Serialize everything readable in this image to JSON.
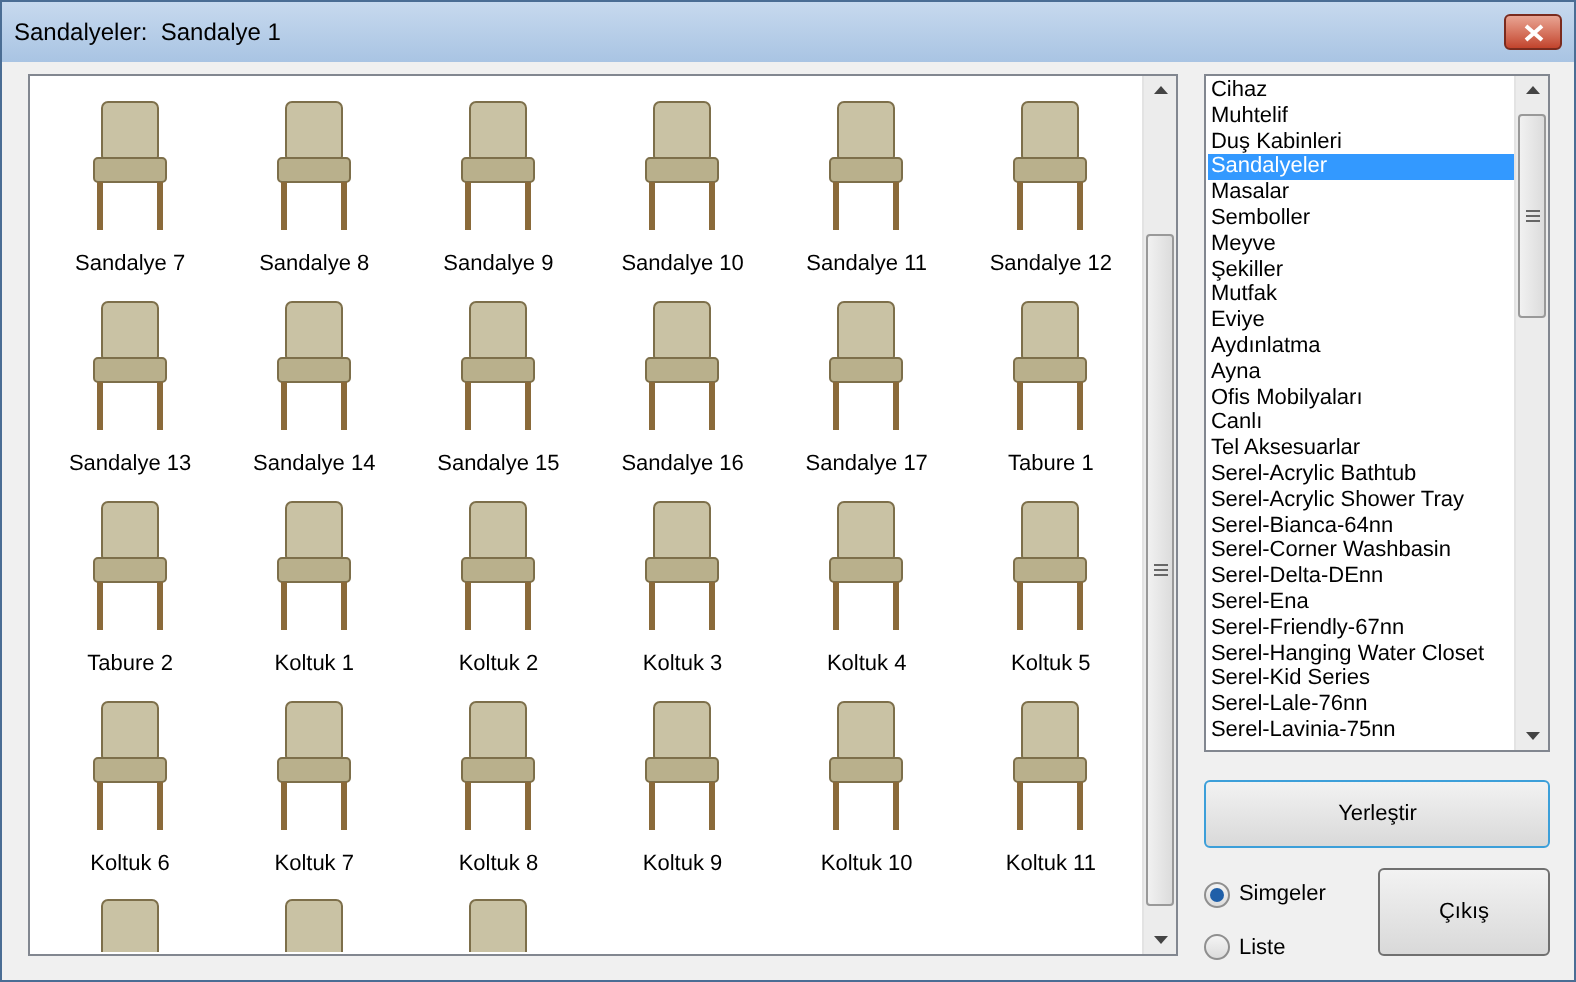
{
  "window": {
    "title": "Sandalyeler:  Sandalye 1"
  },
  "items": [
    {
      "kind": "full",
      "label": "Sandalye 7"
    },
    {
      "kind": "full",
      "label": "Sandalye 8"
    },
    {
      "kind": "full",
      "label": "Sandalye 9"
    },
    {
      "kind": "full",
      "label": "Sandalye 10"
    },
    {
      "kind": "full",
      "label": "Sandalye 11"
    },
    {
      "kind": "full",
      "label": "Sandalye 12"
    },
    {
      "kind": "full",
      "label": "Sandalye 13"
    },
    {
      "kind": "full",
      "label": "Sandalye 14"
    },
    {
      "kind": "full",
      "label": "Sandalye 15"
    },
    {
      "kind": "full",
      "label": "Sandalye 16"
    },
    {
      "kind": "full",
      "label": "Sandalye 17"
    },
    {
      "kind": "full",
      "label": "Tabure 1"
    },
    {
      "kind": "full",
      "label": "Tabure 2"
    },
    {
      "kind": "full",
      "label": "Koltuk 1"
    },
    {
      "kind": "full",
      "label": "Koltuk 2"
    },
    {
      "kind": "full",
      "label": "Koltuk 3"
    },
    {
      "kind": "full",
      "label": "Koltuk 4"
    },
    {
      "kind": "full",
      "label": "Koltuk 5"
    },
    {
      "kind": "full",
      "label": "Koltuk 6"
    },
    {
      "kind": "full",
      "label": "Koltuk 7"
    },
    {
      "kind": "full",
      "label": "Koltuk 8"
    },
    {
      "kind": "full",
      "label": "Koltuk 9"
    },
    {
      "kind": "full",
      "label": "Koltuk 10"
    },
    {
      "kind": "full",
      "label": "Koltuk 11"
    },
    {
      "kind": "cut"
    },
    {
      "kind": "cut"
    },
    {
      "kind": "cut"
    }
  ],
  "categories": [
    {
      "label": "Cihaz",
      "selected": false
    },
    {
      "label": "Muhtelif",
      "selected": false
    },
    {
      "label": "Duş Kabinleri",
      "selected": false
    },
    {
      "label": "Sandalyeler",
      "selected": true
    },
    {
      "label": "Masalar",
      "selected": false
    },
    {
      "label": "Semboller",
      "selected": false
    },
    {
      "label": "Meyve",
      "selected": false
    },
    {
      "label": "Şekiller",
      "selected": false
    },
    {
      "label": "Mutfak",
      "selected": false
    },
    {
      "label": "Eviye",
      "selected": false
    },
    {
      "label": "Aydınlatma",
      "selected": false
    },
    {
      "label": "Ayna",
      "selected": false
    },
    {
      "label": "Ofis Mobilyaları",
      "selected": false
    },
    {
      "label": "Canlı",
      "selected": false
    },
    {
      "label": "Tel Aksesuarlar",
      "selected": false
    },
    {
      "label": "Serel-Acrylic Bathtub",
      "selected": false
    },
    {
      "label": "Serel-Acrylic Shower Tray",
      "selected": false
    },
    {
      "label": "Serel-Bianca-64nn",
      "selected": false
    },
    {
      "label": "Serel-Corner Washbasin",
      "selected": false
    },
    {
      "label": "Serel-Delta-DEnn",
      "selected": false
    },
    {
      "label": "Serel-Ena",
      "selected": false
    },
    {
      "label": "Serel-Friendly-67nn",
      "selected": false
    },
    {
      "label": "Serel-Hanging Water Closet",
      "selected": false
    },
    {
      "label": "Serel-Kid Series",
      "selected": false
    },
    {
      "label": "Serel-Lale-76nn",
      "selected": false
    },
    {
      "label": "Serel-Lavinia-75nn",
      "selected": false
    }
  ],
  "place_button": "Yerleştir",
  "view_options": [
    {
      "label": "Simgeler",
      "selected": true
    },
    {
      "label": "Liste",
      "selected": false
    }
  ],
  "exit_button": "Çıkış"
}
